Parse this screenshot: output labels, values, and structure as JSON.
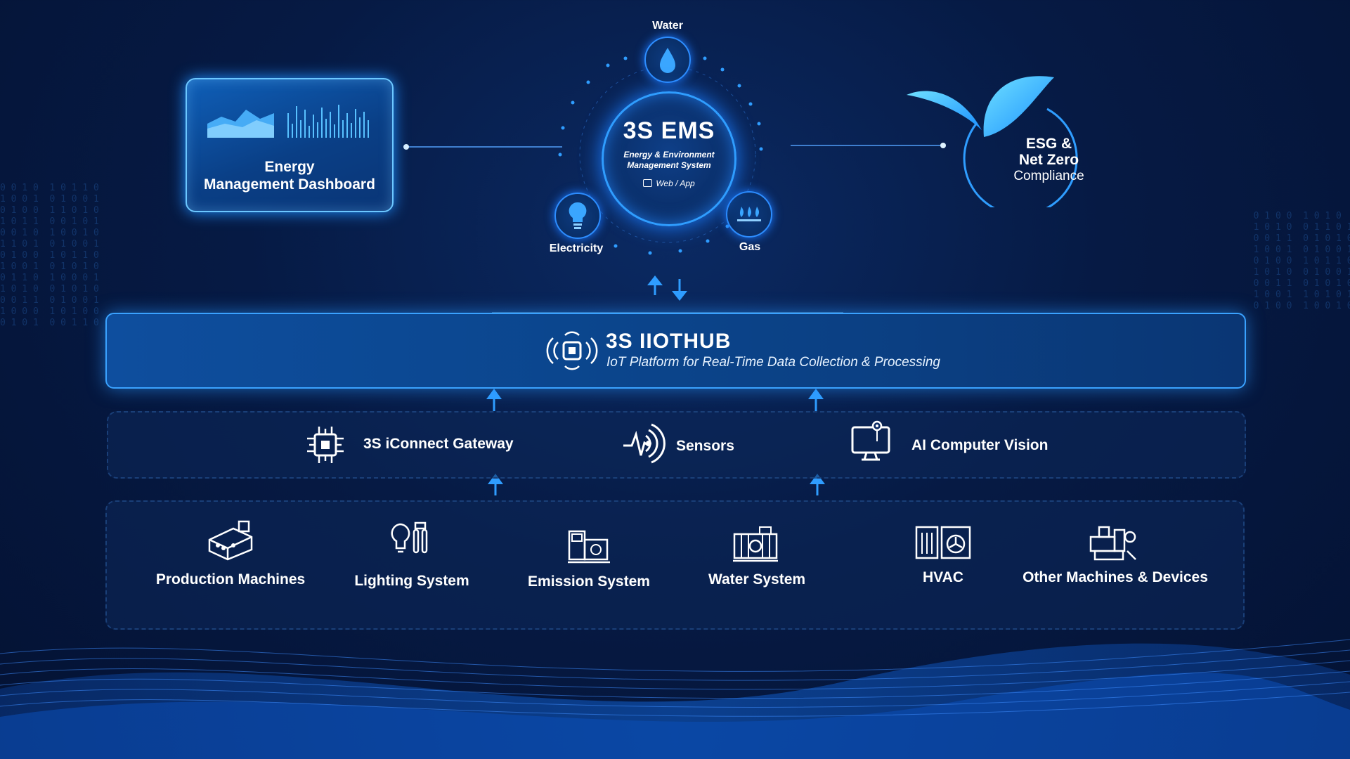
{
  "colors": {
    "accent": "#2f9dff",
    "glow": "#6cc7ff",
    "background": "#061a44"
  },
  "dashboard": {
    "title_line1": "Energy",
    "title_line2": "Management Dashboard"
  },
  "ems": {
    "title": "3S EMS",
    "subtitle_line1": "Energy & Environment",
    "subtitle_line2": "Management System",
    "web_app": "Web / App",
    "nodes": {
      "water": "Water",
      "electricity": "Electricity",
      "gas": "Gas"
    }
  },
  "esg": {
    "line1": "ESG &",
    "line2": "Net Zero",
    "line3": "Compliance"
  },
  "hub": {
    "title": "3S IIOTHUB",
    "subtitle": "IoT Platform for Real-Time Data Collection & Processing"
  },
  "middle": {
    "gateway": "3S iConnect Gateway",
    "sensors": "Sensors",
    "vision": "AI Computer Vision"
  },
  "bottom": {
    "production": "Production Machines",
    "lighting": "Lighting System",
    "emission": "Emission System",
    "water": "Water System",
    "hvac": "HVAC",
    "other": "Other Machines & Devices"
  },
  "icons": [
    "water-drop-icon",
    "light-bulb-icon",
    "gas-flame-icon",
    "monitor-icon",
    "iot-signal-icon",
    "chip-icon",
    "sensor-wave-icon",
    "camera-monitor-icon",
    "production-machine-icon",
    "lamp-icon",
    "emission-icon",
    "water-system-icon",
    "hvac-icon",
    "other-machine-icon",
    "leaf-icon"
  ]
}
